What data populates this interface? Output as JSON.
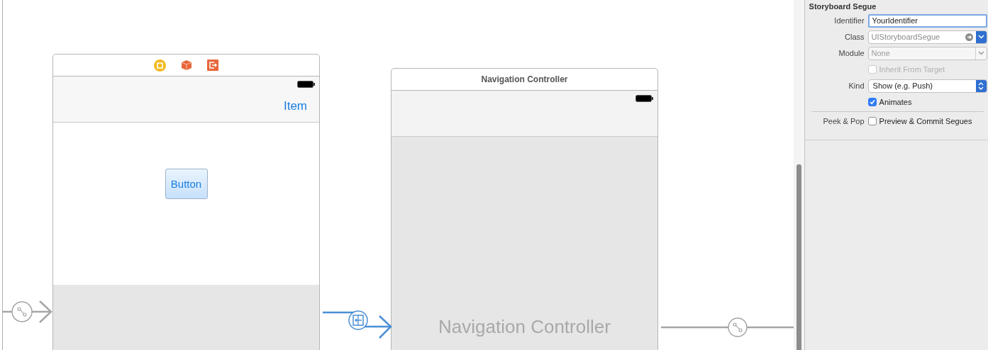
{
  "canvas": {
    "scenes": [
      {
        "kind": "view_controller",
        "nav_item": "Item",
        "button": "Button"
      },
      {
        "kind": "navigation_controller",
        "title": "Navigation Controller",
        "placeholder_label": "Navigation Controller"
      }
    ],
    "connectors": [
      {
        "kind": "entry"
      },
      {
        "kind": "embed"
      },
      {
        "kind": "show"
      }
    ]
  },
  "inspector": {
    "section_title": "Storyboard Segue",
    "rows": [
      {
        "kind": "text",
        "label": "Identifier",
        "value": "YourIdentifier",
        "focused": true
      },
      {
        "kind": "combo",
        "label": "Class",
        "placeholder": "UIStoryboardSegue",
        "disabled": false
      },
      {
        "kind": "combo",
        "label": "Module",
        "placeholder": "None",
        "disabled": true
      },
      {
        "kind": "checkbox",
        "text": "Inherit From Target",
        "checked": false,
        "disabled": true
      },
      {
        "kind": "popup",
        "label": "Kind",
        "value": "Show (e.g. Push)"
      },
      {
        "kind": "checkbox",
        "text": "Animates",
        "checked": true,
        "disabled": false
      },
      {
        "kind": "separator"
      },
      {
        "kind": "checkbox",
        "label": "Peek & Pop",
        "text": "Preview & Commit Segues",
        "checked": false,
        "disabled": false
      }
    ]
  }
}
